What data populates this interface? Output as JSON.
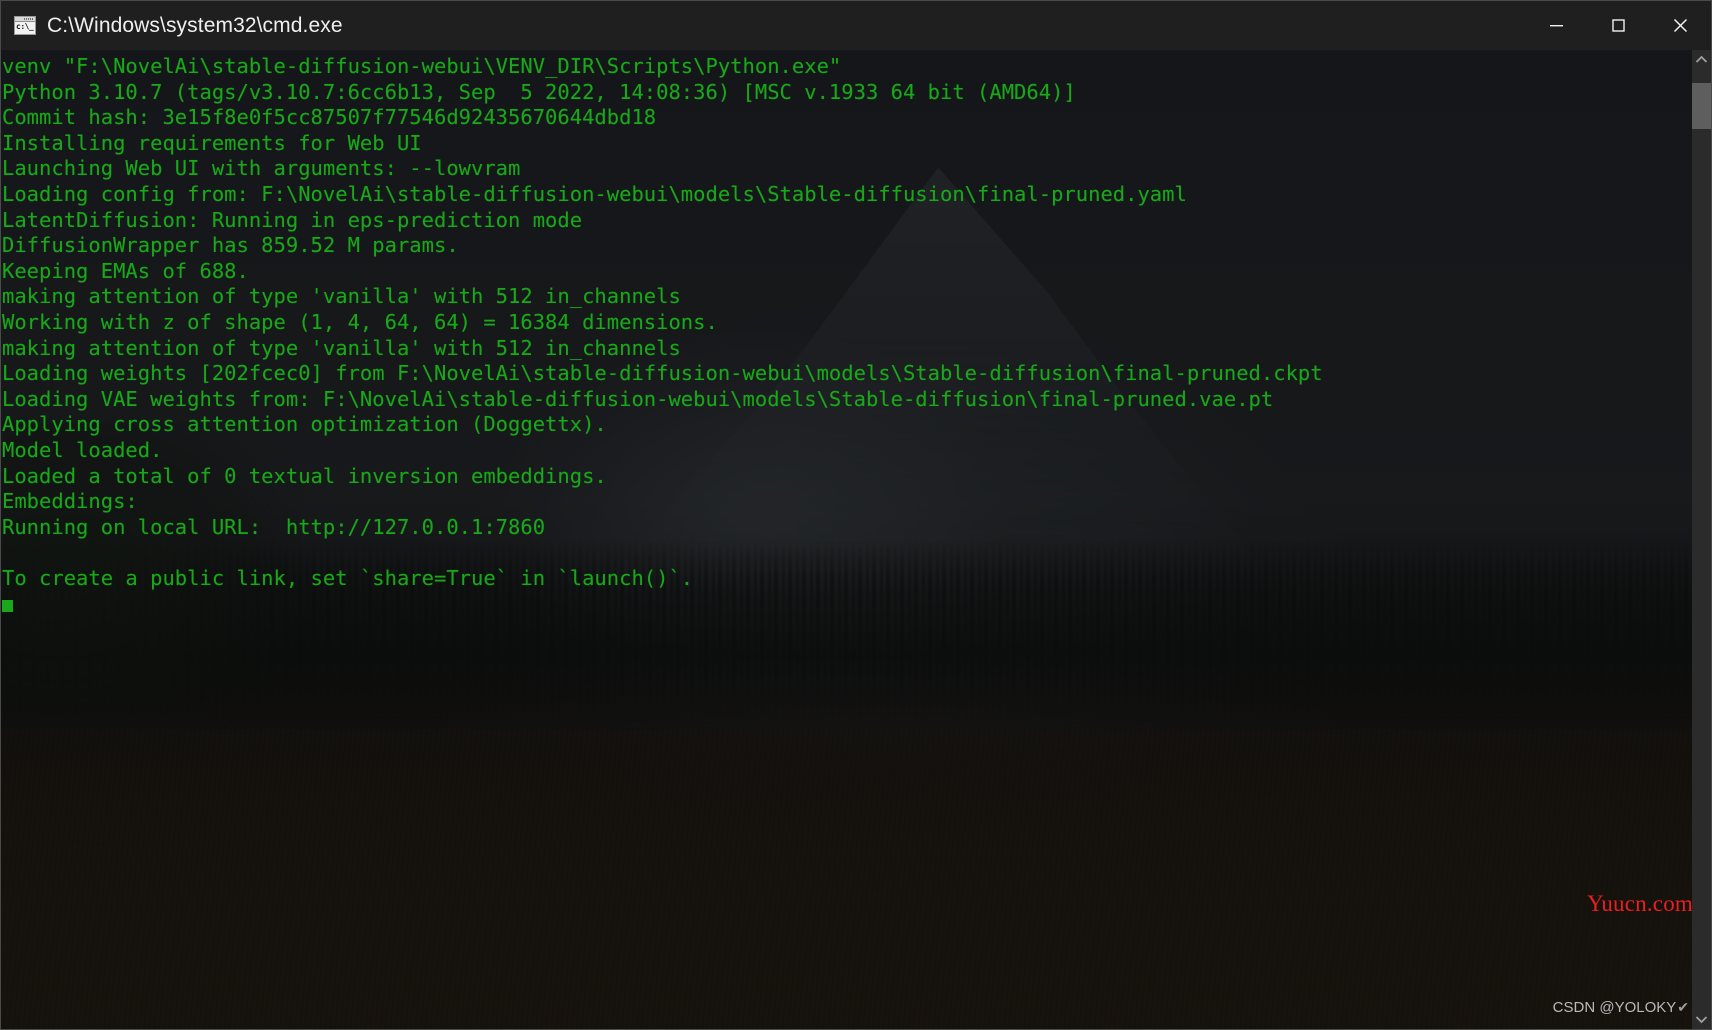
{
  "window": {
    "title": "C:\\Windows\\system32\\cmd.exe",
    "icon": "cmd-icon",
    "controls": {
      "minimize": "minimize-button",
      "maximize": "maximize-button",
      "close": "close-button"
    }
  },
  "console": {
    "text_color": "#19a819",
    "background_color": "#0c0c0c",
    "lines": [
      "venv \"F:\\NovelAi\\stable-diffusion-webui\\VENV_DIR\\Scripts\\Python.exe\"",
      "Python 3.10.7 (tags/v3.10.7:6cc6b13, Sep  5 2022, 14:08:36) [MSC v.1933 64 bit (AMD64)]",
      "Commit hash: 3e15f8e0f5cc87507f77546d92435670644dbd18",
      "Installing requirements for Web UI",
      "Launching Web UI with arguments: --lowvram",
      "Loading config from: F:\\NovelAi\\stable-diffusion-webui\\models\\Stable-diffusion\\final-pruned.yaml",
      "LatentDiffusion: Running in eps-prediction mode",
      "DiffusionWrapper has 859.52 M params.",
      "Keeping EMAs of 688.",
      "making attention of type 'vanilla' with 512 in_channels",
      "Working with z of shape (1, 4, 64, 64) = 16384 dimensions.",
      "making attention of type 'vanilla' with 512 in_channels",
      "Loading weights [202fcec0] from F:\\NovelAi\\stable-diffusion-webui\\models\\Stable-diffusion\\final-pruned.ckpt",
      "Loading VAE weights from: F:\\NovelAi\\stable-diffusion-webui\\models\\Stable-diffusion\\final-pruned.vae.pt",
      "Applying cross attention optimization (Doggettx).",
      "Model loaded.",
      "Loaded a total of 0 textual inversion embeddings.",
      "Embeddings:",
      "Running on local URL:  http://127.0.0.1:7860",
      "",
      "To create a public link, set `share=True` in `launch()`."
    ],
    "local_url": "http://127.0.0.1:7860",
    "cursor": "block-cursor"
  },
  "scrollbar": {
    "up_arrow": "scroll-up-arrow",
    "down_arrow": "scroll-down-arrow",
    "thumb": "scrollbar-thumb"
  },
  "watermarks": {
    "site": "Yuucn.com",
    "site_color": "#e8201f",
    "author": "CSDN @YOLOKY",
    "author_check": "✔"
  }
}
